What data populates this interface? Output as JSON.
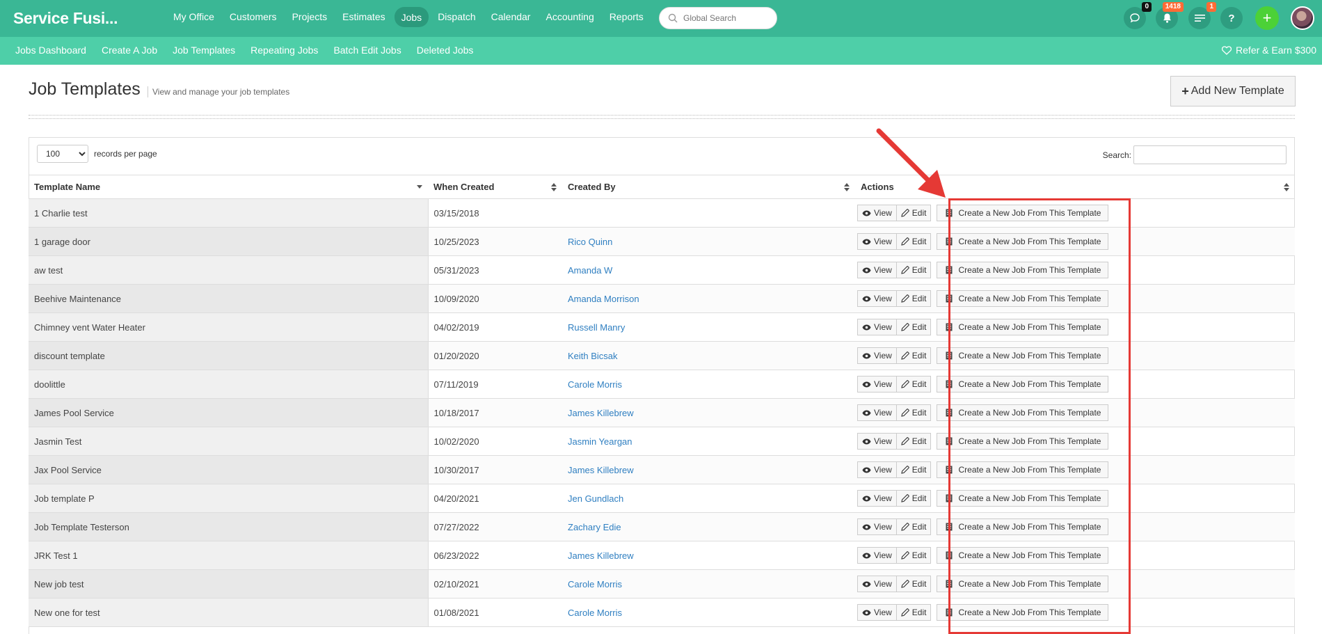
{
  "app": {
    "brand": "Service Fusi..."
  },
  "main_nav": [
    {
      "label": "My Office",
      "active": false
    },
    {
      "label": "Customers",
      "active": false
    },
    {
      "label": "Projects",
      "active": false
    },
    {
      "label": "Estimates",
      "active": false
    },
    {
      "label": "Jobs",
      "active": true
    },
    {
      "label": "Dispatch",
      "active": false
    },
    {
      "label": "Calendar",
      "active": false
    },
    {
      "label": "Accounting",
      "active": false
    },
    {
      "label": "Reports",
      "active": false
    }
  ],
  "global_search": {
    "placeholder": "Global Search"
  },
  "topbar_icons": {
    "chat_badge": "0",
    "notifications_badge": "1418",
    "tasks_badge": "1",
    "help_label": "?",
    "add_label": "+"
  },
  "sub_nav": [
    {
      "label": "Jobs Dashboard"
    },
    {
      "label": "Create A Job"
    },
    {
      "label": "Job Templates"
    },
    {
      "label": "Repeating Jobs"
    },
    {
      "label": "Batch Edit Jobs"
    },
    {
      "label": "Deleted Jobs"
    }
  ],
  "refer": {
    "label": "Refer & Earn $300"
  },
  "page": {
    "title": "Job Templates",
    "subtitle": "View and manage your job templates",
    "add_button_label": "Add New Template"
  },
  "table_controls": {
    "records_value": "100",
    "records_label": "records per page",
    "search_label": "Search:"
  },
  "columns": {
    "name": "Template Name",
    "when": "When Created",
    "by": "Created By",
    "actions": "Actions"
  },
  "action_labels": {
    "view": "View",
    "edit": "Edit",
    "create": "Create a New Job From This Template"
  },
  "rows": [
    {
      "name": "1 Charlie test",
      "when": "03/15/2018",
      "by": ""
    },
    {
      "name": "1 garage door",
      "when": "10/25/2023",
      "by": "Rico Quinn"
    },
    {
      "name": "aw test",
      "when": "05/31/2023",
      "by": "Amanda W"
    },
    {
      "name": "Beehive Maintenance",
      "when": "10/09/2020",
      "by": "Amanda Morrison"
    },
    {
      "name": "Chimney vent Water Heater",
      "when": "04/02/2019",
      "by": "Russell Manry"
    },
    {
      "name": "discount template",
      "when": "01/20/2020",
      "by": "Keith Bicsak"
    },
    {
      "name": "doolittle",
      "when": "07/11/2019",
      "by": "Carole Morris"
    },
    {
      "name": "James Pool Service",
      "when": "10/18/2017",
      "by": "James Killebrew"
    },
    {
      "name": "Jasmin Test",
      "when": "10/02/2020",
      "by": "Jasmin Yeargan"
    },
    {
      "name": "Jax Pool Service",
      "when": "10/30/2017",
      "by": "James Killebrew"
    },
    {
      "name": "Job template P",
      "when": "04/20/2021",
      "by": "Jen Gundlach"
    },
    {
      "name": "Job Template Testerson",
      "when": "07/27/2022",
      "by": "Zachary Edie"
    },
    {
      "name": "JRK Test 1",
      "when": "06/23/2022",
      "by": "James Killebrew"
    },
    {
      "name": "New job test",
      "when": "02/10/2021",
      "by": "Carole Morris"
    },
    {
      "name": "New one for test",
      "when": "01/08/2021",
      "by": "Carole Morris"
    }
  ],
  "colors": {
    "topbar": "#3ab795",
    "subbar": "#4ecfa8",
    "link": "#2f7fc1",
    "highlight": "#e53935"
  }
}
